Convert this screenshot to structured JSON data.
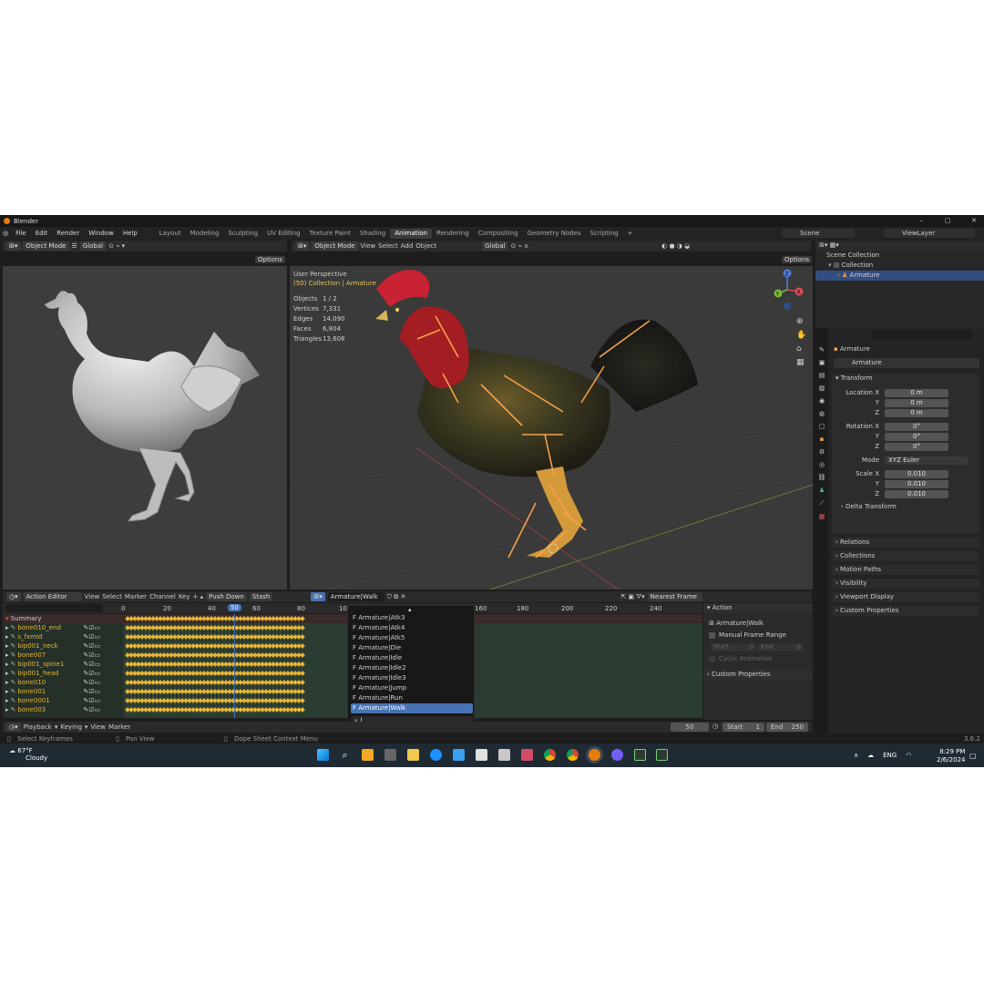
{
  "titlebar": {
    "title": "Blender",
    "min": "–",
    "max": "▢",
    "close": "✕"
  },
  "menus": [
    "File",
    "Edit",
    "Render",
    "Window",
    "Help"
  ],
  "workspaces": [
    "Layout",
    "Modeling",
    "Sculpting",
    "UV Editing",
    "Texture Paint",
    "Shading",
    "Animation",
    "Rendering",
    "Compositing",
    "Geometry Nodes",
    "Scripting"
  ],
  "active_workspace": "Animation",
  "scene": {
    "scene_name": "Scene",
    "view_layer": "ViewLayer"
  },
  "left_view": {
    "mode": "Object Mode",
    "orientation": "Global",
    "options": "Options"
  },
  "main_view": {
    "mode": "Object Mode",
    "menu": [
      "View",
      "Select",
      "Add",
      "Object"
    ],
    "orientation": "Global",
    "options": "Options",
    "perspective": "User Perspective",
    "collection": "(50) Collection | Armature",
    "stats": [
      {
        "label": "Objects",
        "value": "1 / 2"
      },
      {
        "label": "Vertices",
        "value": "7,331"
      },
      {
        "label": "Edges",
        "value": "14,090"
      },
      {
        "label": "Faces",
        "value": "6,804"
      },
      {
        "label": "Triangles",
        "value": "13,608"
      }
    ],
    "gizmo": {
      "x": "X",
      "y": "Y",
      "z": "Z"
    }
  },
  "outliner": {
    "scene_collection": "Scene Collection",
    "collection": "Collection",
    "armature": "Armature"
  },
  "properties": {
    "object_name": "Armature",
    "object_field": "Armature",
    "transform": "Transform",
    "location_label": "Location X",
    "location": [
      "0 m",
      "0 m",
      "0 m"
    ],
    "rotation_label": "Rotation X",
    "rotation": [
      "0°",
      "0°",
      "0°"
    ],
    "mode_label": "Mode",
    "mode_value": "XYZ Euler",
    "scale_label": "Scale X",
    "scale": [
      "0.010",
      "0.010",
      "0.010"
    ],
    "axis_y": "Y",
    "axis_z": "Z",
    "delta": "Delta Transform",
    "sections": [
      "Relations",
      "Collections",
      "Motion Paths",
      "Visibility",
      "Viewport Display",
      "Custom Properties"
    ]
  },
  "action_editor": {
    "mode": "Action Editor",
    "menu": [
      "View",
      "Select",
      "Marker",
      "Channel",
      "Key"
    ],
    "push_down": "Push Down",
    "stash": "Stash",
    "action_name": "Armature|Walk",
    "snap": "Nearest Frame",
    "ruler": [
      "0",
      "20",
      "40",
      "50",
      "60",
      "80",
      "100",
      "160",
      "180",
      "200",
      "220",
      "240"
    ],
    "current_frame": "50",
    "summary": "Summary",
    "channels": [
      "bone010_end",
      "s_fxmid",
      "bip001_neck",
      "bone007",
      "bip001_spine1",
      "bip001_head",
      "bone010",
      "bone001",
      "bone0001",
      "bone003"
    ],
    "dropdown_items": [
      "F Armature|Atk3",
      "F Armature|Atk4",
      "F Armature|Atk5",
      "F Armature|Die",
      "F Armature|Idle",
      "F Armature|Idle2",
      "F Armature|Idle3",
      "F Armature|Jump",
      "F Armature|Run",
      "F Armature|Walk"
    ],
    "selected_item": "F Armature|Walk",
    "side_panel": {
      "tab": "Action",
      "action": "Armature|Walk",
      "manual_range": "Manual Frame Range",
      "start": "Start",
      "start_val": "0",
      "end": "End",
      "end_val": "0",
      "cyclic": "Cyclic Animation",
      "custom": "Custom Properties"
    }
  },
  "timeline": {
    "playback": "Playback",
    "keying": "Keying",
    "view": "View",
    "marker": "Marker",
    "frame": "50",
    "start_label": "Start",
    "start": "1",
    "end_label": "End",
    "end": "250"
  },
  "statusbar": {
    "select": "Select Keyframes",
    "pan": "Pan View",
    "context": "Dope Sheet Context Menu",
    "version": "3.6.2"
  },
  "taskbar": {
    "temp": "67°F",
    "weather": "Cloudy",
    "lang": "ENG",
    "time": "8:29 PM",
    "date": "2/6/2024"
  },
  "colors": {
    "accent": "#4772b3",
    "keyframe": "#e8b533",
    "bone": "#f5a04a",
    "active_ws": "#3c3c3c"
  }
}
